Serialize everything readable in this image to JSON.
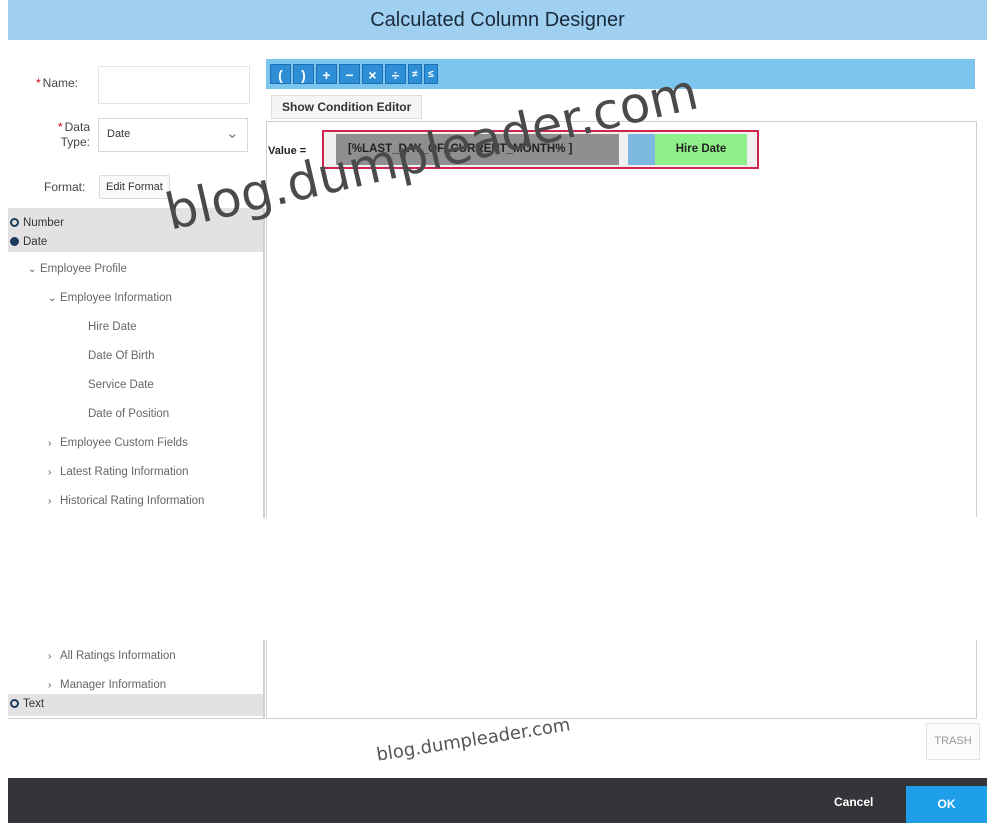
{
  "window": {
    "title": "Calculated Column Designer"
  },
  "form": {
    "name_label": "Name:",
    "name_value": "",
    "data_type_label": "Data Type:",
    "data_type_value": "Date",
    "format_label": "Format:",
    "edit_format_label": "Edit Format",
    "required_mark": "*"
  },
  "tree": {
    "number": "Number",
    "date": "Date",
    "employee_profile": "Employee Profile",
    "employee_information": "Employee Information",
    "hire_date": "Hire Date",
    "date_of_birth": "Date Of Birth",
    "service_date": "Service Date",
    "date_of_position": "Date of Position",
    "employee_custom_fields": "Employee Custom Fields",
    "latest_rating": "Latest Rating Information",
    "historical_rating": "Historical Rating Information",
    "all_ratings": "All Ratings Information",
    "manager_information": "Manager Information",
    "text": "Text"
  },
  "toolbar": {
    "icons": [
      "(",
      ")",
      "+",
      "−",
      "×",
      "÷",
      "≠",
      "≤"
    ]
  },
  "editor": {
    "show_condition_editor": "Show Condition Editor",
    "value_label": "Value =",
    "expr_token_1": "[%LAST_DAY_OF_CURRENT_MONTH% ]",
    "expr_token_2": "Hire Date",
    "trash_label": "TRASH"
  },
  "footer": {
    "cancel_label": "Cancel",
    "ok_label": "OK"
  },
  "watermark": {
    "text_large": "blog.dumpleader.com",
    "text_small": "blog.dumpleader.com"
  },
  "colors": {
    "title_bar": "#9fd0f0",
    "toolbar": "#7cc6ee",
    "ok_button": "#1f9fe8",
    "footer": "#333538",
    "highlight_border": "#d0254a"
  }
}
